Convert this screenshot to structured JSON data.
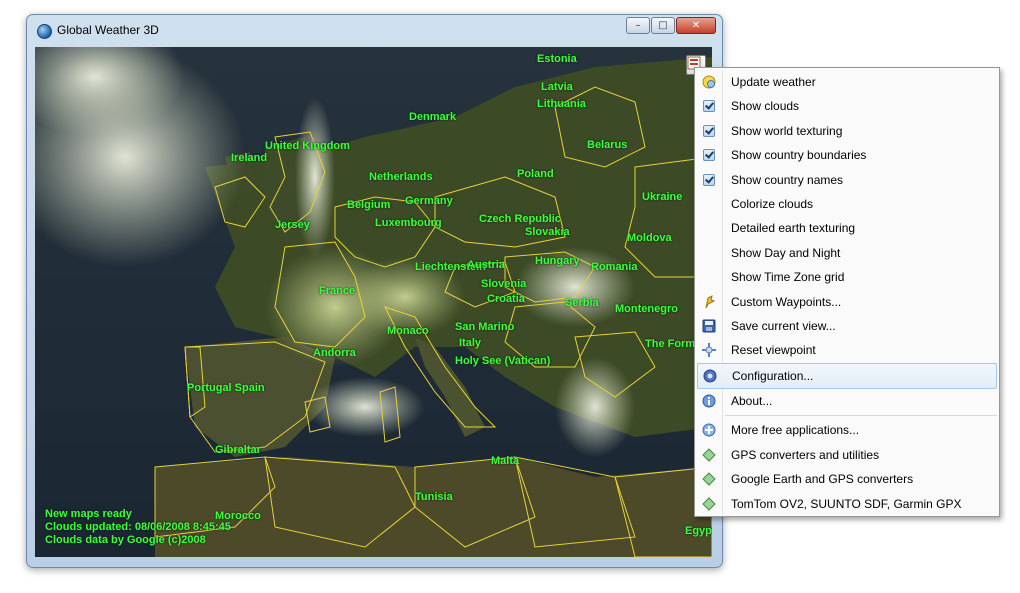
{
  "window": {
    "title": "Global Weather 3D",
    "controls": {
      "minimize": "–",
      "maximize": "□",
      "close": "✕"
    }
  },
  "map": {
    "labels": [
      {
        "text": "Estonia"
      },
      {
        "text": "Latvia"
      },
      {
        "text": "Lithuania"
      },
      {
        "text": "Denmark"
      },
      {
        "text": "Belarus"
      },
      {
        "text": "United Kingdom"
      },
      {
        "text": "Ireland"
      },
      {
        "text": "Netherlands"
      },
      {
        "text": "Poland"
      },
      {
        "text": "Belgium"
      },
      {
        "text": "Germany"
      },
      {
        "text": "Ukraine"
      },
      {
        "text": "Luxembourg"
      },
      {
        "text": "Czech Republic"
      },
      {
        "text": "Slovakia"
      },
      {
        "text": "Jersey"
      },
      {
        "text": "Moldova"
      },
      {
        "text": "Liechtenstein"
      },
      {
        "text": "Austria"
      },
      {
        "text": "Hungary"
      },
      {
        "text": "Romania"
      },
      {
        "text": "France"
      },
      {
        "text": "Slovenia"
      },
      {
        "text": "Croatia"
      },
      {
        "text": "Serbia"
      },
      {
        "text": "Montenegro"
      },
      {
        "text": "Monaco"
      },
      {
        "text": "San Marino"
      },
      {
        "text": "Andorra"
      },
      {
        "text": "Italy"
      },
      {
        "text": "The Former"
      },
      {
        "text": "Holy See (Vatican)"
      },
      {
        "text": "Portugal Spain"
      },
      {
        "text": "Gibraltar"
      },
      {
        "text": "Malta"
      },
      {
        "text": "Tunisia"
      },
      {
        "text": "Morocco"
      },
      {
        "text": "Egypt"
      }
    ],
    "status": [
      "New maps ready",
      "Clouds updated: 08/06/2008 8:45:45",
      "Clouds data by Google (c)2008"
    ]
  },
  "menu": {
    "items": [
      {
        "label": "Update weather",
        "icon": "weather-update-icon"
      },
      {
        "label": "Show clouds",
        "checked": true
      },
      {
        "label": "Show world texturing",
        "checked": true
      },
      {
        "label": "Show country boundaries",
        "checked": true
      },
      {
        "label": "Show country names",
        "checked": true
      },
      {
        "label": "Colorize clouds"
      },
      {
        "label": "Detailed earth texturing"
      },
      {
        "label": "Show Day and Night"
      },
      {
        "label": "Show Time Zone grid"
      },
      {
        "label": "Custom Waypoints...",
        "icon": "waypoint-pin-icon"
      },
      {
        "label": "Save current view...",
        "icon": "save-disk-icon"
      },
      {
        "label": "Reset viewpoint",
        "icon": "crosshair-icon"
      },
      {
        "label": "Configuration...",
        "icon": "gear-icon",
        "highlighted": true
      },
      {
        "label": "About...",
        "icon": "info-icon"
      },
      {
        "label": "More free applications...",
        "icon": "plus-circle-icon"
      },
      {
        "label": "GPS converters and utilities",
        "icon": "gps-icon"
      },
      {
        "label": "Google Earth and GPS converters",
        "icon": "gps-icon"
      },
      {
        "label": "TomTom OV2, SUUNTO SDF, Garmin GPX",
        "icon": "gps-icon"
      }
    ]
  },
  "colors": {
    "label_green": "#3dff3d",
    "border_yellow": "#e6d23a",
    "menu_highlight": "#e3edf8"
  }
}
